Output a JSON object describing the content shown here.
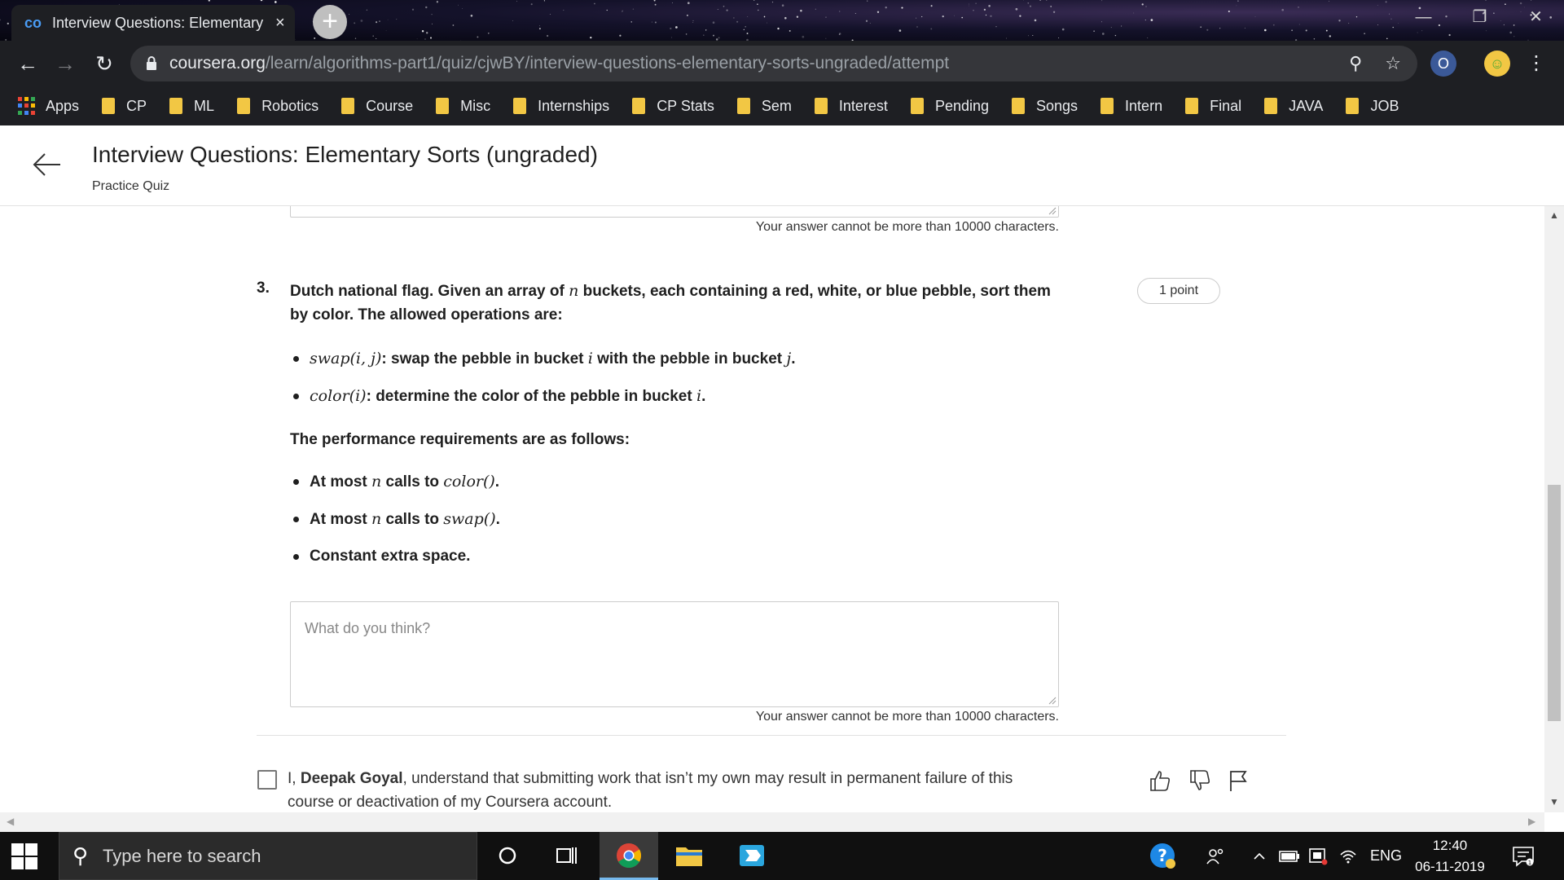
{
  "browser": {
    "tab": {
      "title": "Interview Questions: Elementary",
      "close": "×",
      "favicon": "co"
    },
    "new_tab": "+",
    "window_controls": {
      "minimize": "—",
      "restore": "❐",
      "close": "✕"
    },
    "nav": {
      "back": "←",
      "forward": "→",
      "reload": "↻"
    },
    "address": {
      "host": "coursera.org",
      "path": "/learn/algorithms-part1/quiz/cjwBY/interview-questions-elementary-sorts-ungraded/attempt",
      "zoom_icon": "⚲",
      "star_icon": "☆"
    },
    "menu_icon": "⋮",
    "bookmarks": [
      {
        "label": "Apps",
        "kind": "apps"
      },
      {
        "label": "CP",
        "kind": "folder"
      },
      {
        "label": "ML",
        "kind": "folder"
      },
      {
        "label": "Robotics",
        "kind": "folder"
      },
      {
        "label": "Course",
        "kind": "folder"
      },
      {
        "label": "Misc",
        "kind": "folder"
      },
      {
        "label": "Internships",
        "kind": "folder"
      },
      {
        "label": "CP Stats",
        "kind": "folder"
      },
      {
        "label": "Sem",
        "kind": "folder"
      },
      {
        "label": "Interest",
        "kind": "folder"
      },
      {
        "label": "Pending",
        "kind": "folder"
      },
      {
        "label": "Songs",
        "kind": "folder"
      },
      {
        "label": "Intern",
        "kind": "folder"
      },
      {
        "label": "Final",
        "kind": "folder"
      },
      {
        "label": "JAVA",
        "kind": "folder"
      },
      {
        "label": "JOB",
        "kind": "folder"
      }
    ]
  },
  "header": {
    "back_icon": "←",
    "title": "Interview Questions: Elementary Sorts (ungraded)",
    "subtitle": "Practice Quiz"
  },
  "previous_answer": {
    "char_limit": "Your answer cannot be more than 10000 characters."
  },
  "question": {
    "number": "3.",
    "points": "1 point",
    "intro_part1": "Dutch national flag. Given an array of ",
    "intro_var": "n",
    "intro_part2": " buckets, each containing a red, white, or blue pebble, sort them by color. The allowed operations are:",
    "operations": [
      {
        "math": "swap(i, j)",
        "text_a": ": swap the pebble in bucket ",
        "var_a": "i",
        "text_b": " with the pebble in bucket ",
        "var_b": "j",
        "text_c": "."
      },
      {
        "math": "color(i)",
        "text_a": ": determine the color of the pebble in bucket ",
        "var_a": "i",
        "text_b": ".",
        "var_b": "",
        "text_c": ""
      }
    ],
    "performance_heading": "The performance requirements are as follows:",
    "requirements": [
      {
        "text_a": "At most ",
        "var": "n",
        "text_b": " calls to ",
        "math": "color()",
        "text_c": "."
      },
      {
        "text_a": "At most ",
        "var": "n",
        "text_b": " calls to ",
        "math": "swap()",
        "text_c": "."
      },
      {
        "text_a": "Constant extra space.",
        "var": "",
        "text_b": "",
        "math": "",
        "text_c": ""
      }
    ],
    "answer_placeholder": "What do you think?",
    "char_limit": "Your answer cannot be more than 10000 characters."
  },
  "honor_code": {
    "prefix": "I, ",
    "name": "Deepak Goyal",
    "suffix": ", understand that submitting work that isn’t my own may result in permanent failure of this course or deactivation of my Coursera account.",
    "checked": false
  },
  "feedback_icons": [
    "thumbs-up-icon",
    "thumbs-down-icon",
    "flag-icon"
  ],
  "taskbar": {
    "search_placeholder": "Type here to search",
    "language": "ENG",
    "time": "12:40",
    "date": "06-11-2019"
  }
}
